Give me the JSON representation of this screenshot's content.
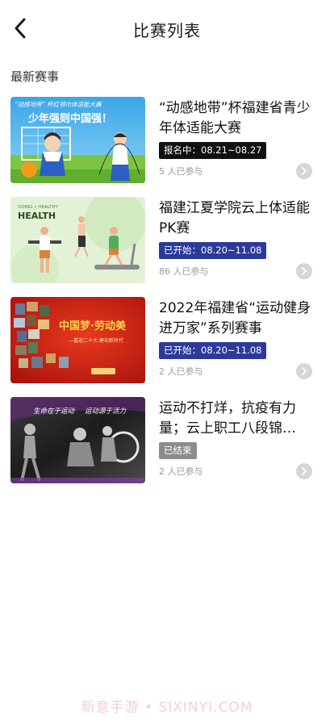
{
  "header": {
    "title": "比赛列表",
    "back_icon": "chevron-left-icon"
  },
  "section": {
    "title": "最新赛事"
  },
  "events": [
    {
      "title": "“动感地带”杯福建省青少年体适能大赛",
      "badge": "报名中：08.21~08.27",
      "status": "signup",
      "participants": "5 人已参与",
      "thumb_title": "“动感地带” 杯红领巾体适能大赛",
      "thumb_slogan": "少年强则中国强！"
    },
    {
      "title": "福建江夏学院云上体适能PK赛",
      "badge": "已开始：08.20~11.08",
      "status": "started",
      "participants": "86 人已参与",
      "thumb_title": "HEALTH",
      "thumb_small": "DOING • HEALTHY"
    },
    {
      "title": "2022年福建省“运动健身进万家”系列赛事",
      "badge": "已开始：08.20~11.08",
      "status": "started",
      "participants": "2 人已参与",
      "thumb_title": "中国梦·劳动美",
      "thumb_sub": "—喜迎二十大 建功新时代"
    },
    {
      "title": "运动不打烊，抗疫有力量；云上职工八段锦…",
      "badge": "已结束",
      "status": "ended",
      "participants": "2 人已参与",
      "thumb_text_a": "生命在于运动",
      "thumb_text_b": "运动源于活力"
    }
  ],
  "watermark": "新意手游 • SIXINYI.COM"
}
